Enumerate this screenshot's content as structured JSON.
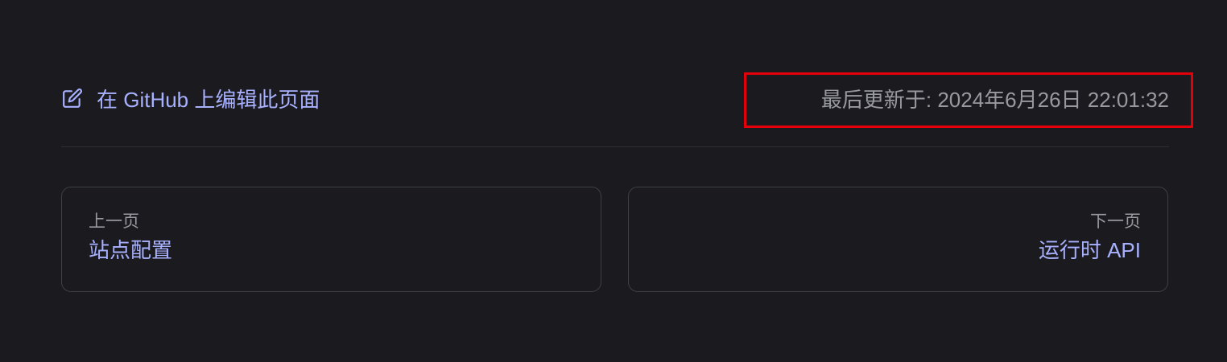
{
  "edit_link": {
    "label": "在 GitHub 上编辑此页面",
    "icon": "edit-icon"
  },
  "last_updated": {
    "label": "最后更新于: 2024年6月26日 22:01:32"
  },
  "pager": {
    "prev": {
      "desc": "上一页",
      "title": "站点配置"
    },
    "next": {
      "desc": "下一页",
      "title": "运行时 API"
    }
  },
  "colors": {
    "background": "#1b1b1f",
    "link": "#a8b1ff",
    "muted_text": "#98989f",
    "divider": "#2e2e32",
    "card_border": "#3c3f44",
    "highlight": "#e3000b"
  }
}
